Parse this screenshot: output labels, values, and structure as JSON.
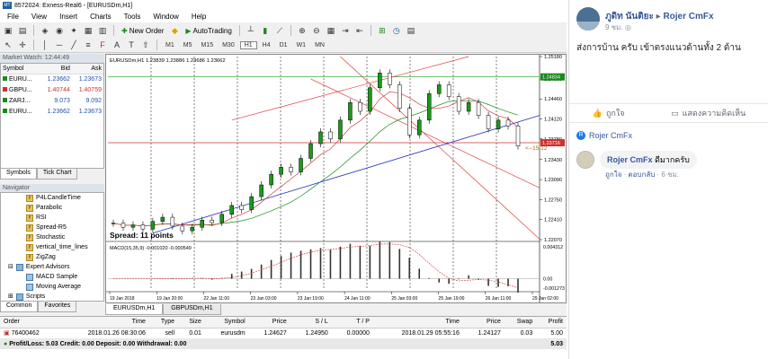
{
  "window": {
    "title": "8572024: Exness-Real6 - [EURUSDm,H1]",
    "logo": "MT"
  },
  "menu": [
    "File",
    "View",
    "Insert",
    "Charts",
    "Tools",
    "Window",
    "Help"
  ],
  "toolbar": {
    "new_order": "New Order",
    "autotrading": "AutoTrading",
    "timeframes": [
      "M1",
      "M5",
      "M15",
      "M30",
      "H1",
      "H4",
      "D1",
      "W1",
      "MN"
    ]
  },
  "market_watch": {
    "title": "Market Watch: 12:44:49",
    "headers": [
      "Symbol",
      "Bid",
      "Ask"
    ],
    "rows": [
      {
        "symbol": "EURU...",
        "bid": "1.23662",
        "ask": "1.23673",
        "color": "#1a8a1a"
      },
      {
        "symbol": "GBPU...",
        "bid": "1.40744",
        "ask": "1.40759",
        "color": "#d03030"
      },
      {
        "symbol": "ZARJ...",
        "bid": "9.073",
        "ask": "9.092",
        "color": "#1a8a1a"
      },
      {
        "symbol": "EURU...",
        "bid": "1.23662",
        "ask": "1.23673",
        "color": "#1a8a1a"
      }
    ],
    "tabs": [
      "Symbols",
      "Tick Chart"
    ]
  },
  "navigator": {
    "title": "Navigator",
    "items": [
      "P4LCandleTime",
      "Parabolic",
      "RSI",
      "Spread-R5",
      "Stochastic",
      "vertical_time_lines",
      "ZigZag"
    ],
    "expert_advisors": "Expert Advisors",
    "ea_items": [
      "MACD Sample",
      "Moving Average"
    ],
    "scripts": "Scripts",
    "tabs": [
      "Common",
      "Favorites"
    ]
  },
  "chart": {
    "info": "EURUSDm,H1 1.23839 1.23886 1.23686 1.23662",
    "spread": "Spread: 11 points",
    "countdown": "<--15:12",
    "macd_label": "MACD(15,35,9) -0.001020 -0.000549",
    "price_ticks": [
      "1.25180",
      "1.24800",
      "1.24460",
      "1.24120",
      "1.23780",
      "1.23430",
      "1.23090",
      "1.22750",
      "1.22410",
      "1.22070"
    ],
    "highlight_green": "1.24834",
    "highlight_red": "1.23716",
    "macd_ticks": [
      "0.004312",
      "0.00",
      "-0.001273"
    ],
    "time_ticks": [
      "19 Jan 2018",
      "19 Jan 20:00",
      "22 Jan 11:00",
      "23 Jan 03:00",
      "23 Jan 19:00",
      "24 Jan 11:00",
      "25 Jan 03:00",
      "25 Jan 19:00",
      "26 Jan 11:00",
      "29 Jan 02:00"
    ],
    "tabs": [
      "EURUSDm,H1",
      "GBPUSDm,H1"
    ]
  },
  "chart_data": {
    "type": "line",
    "title": "EURUSDm,H1",
    "ylabel": "",
    "ylim": [
      1.2207,
      1.2518
    ],
    "price_series": [
      1.2235,
      1.2228,
      1.2232,
      1.2225,
      1.2238,
      1.2245,
      1.223,
      1.2222,
      1.2228,
      1.224,
      1.2236,
      1.225,
      1.2265,
      1.2258,
      1.228,
      1.23,
      1.2318,
      1.233,
      1.2322,
      1.2345,
      1.237,
      1.239,
      1.2378,
      1.241,
      1.244,
      1.2425,
      1.2465,
      1.249,
      1.247,
      1.243,
      1.2385,
      1.241,
      1.2455,
      1.247,
      1.245,
      1.2425,
      1.244,
      1.2418,
      1.2395,
      1.241,
      1.24,
      1.2366
    ],
    "macd_ylim": [
      -0.001273,
      0.004312
    ]
  },
  "terminal": {
    "headers": [
      "Order",
      "Time",
      "Type",
      "Size",
      "Symbol",
      "Price",
      "S / L",
      "T / P",
      "Time",
      "Price",
      "Swap",
      "Profit"
    ],
    "rows": [
      [
        "76400462",
        "2018.01.26 08:30:06",
        "sell",
        "0.01",
        "eurusdm",
        "1.24627",
        "1.24950",
        "0.00000",
        "2018.01.29 05:55:16",
        "1.24127",
        "0.03",
        "5.00"
      ]
    ],
    "summary": "Profit/Loss: 5.03  Credit: 0.00  Deposit: 0.00  Withdrawal: 0.00",
    "summary_total": "5.03"
  },
  "facebook": {
    "author": "ภูดิท นันติยะ",
    "page_name": "Rojer CmFx",
    "time": "9 ชม.",
    "post_text": "ส่งการบ้าน ครับ เข้าตรงแนวด้านทั้ง 2 ด้าน",
    "like": "ถูกใจ",
    "comment": "แสดงความคิดเห็น",
    "page_label": "Rojer CmFx",
    "commenter": "Rojer CmFx",
    "comment_text": "ดีมากครับ",
    "comment_like": "ถูกใจ",
    "comment_reply": "ตอบกลับ",
    "comment_time": "6 ชม."
  }
}
